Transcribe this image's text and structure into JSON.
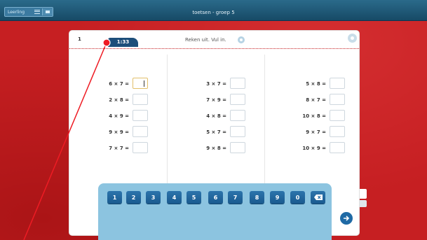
{
  "topbar": {
    "title": "toetsen - groep 5",
    "user_button_label": "Leerling",
    "menu_icon": "hamburger-icon",
    "camera_icon": "camera-icon",
    "background_color": "#174a66"
  },
  "card": {
    "question_number": "1",
    "timer": "1:33",
    "instruction": "Reken uit. Vul in.",
    "speaker_icon": "speaker-icon",
    "help_icon": "help-icon",
    "columns": [
      {
        "rows": [
          {
            "expression": "6 × 7 =",
            "value": ""
          },
          {
            "expression": "2 × 8 =",
            "value": ""
          },
          {
            "expression": "4 × 9 =",
            "value": ""
          },
          {
            "expression": "9 × 9 =",
            "value": ""
          },
          {
            "expression": "7 × 7 =",
            "value": ""
          }
        ]
      },
      {
        "rows": [
          {
            "expression": "3 × 7 =",
            "value": ""
          },
          {
            "expression": "7 × 9 =",
            "value": ""
          },
          {
            "expression": "4 × 8 =",
            "value": ""
          },
          {
            "expression": "5 × 7 =",
            "value": ""
          },
          {
            "expression": "9 × 8 =",
            "value": ""
          }
        ]
      },
      {
        "rows": [
          {
            "expression": "5 × 8 =",
            "value": ""
          },
          {
            "expression": "8 × 7 =",
            "value": ""
          },
          {
            "expression": "10 × 8 =",
            "value": ""
          },
          {
            "expression": "9 × 7 =",
            "value": ""
          },
          {
            "expression": "10 × 9 =",
            "value": ""
          }
        ]
      }
    ]
  },
  "keypad": {
    "keys": [
      "1",
      "2",
      "3",
      "4",
      "5",
      "6",
      "7",
      "8",
      "9",
      "0"
    ],
    "backspace_icon": "backspace-icon"
  },
  "next_button_icon": "arrow-right-icon",
  "colors": {
    "background": "#c61f22",
    "accent": "#1d4e7a",
    "keypad": "#8cc4e0",
    "key": "#1f6aa5"
  }
}
